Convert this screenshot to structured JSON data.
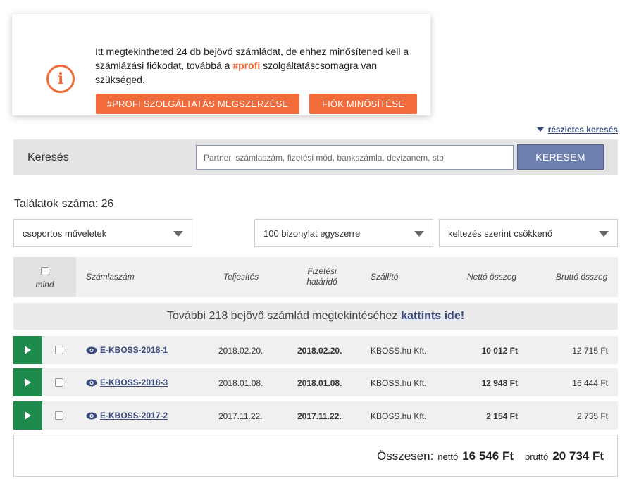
{
  "notice": {
    "text_before": "Itt megtekintheted 24 db bejövő számládat, de ehhez minősítened kell a számlázási fiókodat, továbbá a ",
    "highlight": "#profi",
    "text_after": " szolgáltatáscsomagra van szükséged.",
    "profi_button": "#PROFI SZOLGÁLTATÁS MEGSZERZÉSE",
    "fiok_button": "FIÓK MINŐSÍTÉSE",
    "icon": "info-icon",
    "accent": "#f26b3a"
  },
  "advanced_search": "részletes keresés",
  "search": {
    "label": "Keresés",
    "placeholder": "Partner, számlaszám, fizetési mód, bankszámla, devizanem, stb",
    "button": "KERESEM"
  },
  "results": {
    "count_label": "Találatok száma: 26"
  },
  "selects": {
    "group_actions": "csoportos műveletek",
    "per_page": "100 bizonylat egyszerre",
    "sort": "keltezés szerint csökkenő"
  },
  "table": {
    "select_all": "mind",
    "headers": {
      "invoice": "Számlaszám",
      "fulfillment": "Teljesítés",
      "due_line1": "Fizetési",
      "due_line2": "határidő",
      "supplier": "Szállító",
      "net": "Nettó összeg",
      "gross": "Bruttó összeg"
    },
    "more_text": "További 218 bejövő számlád megtekintéséhez",
    "more_link": "kattints ide!",
    "rows": [
      {
        "invoice": "E-KBOSS-2018-1",
        "fulfillment": "2018.02.20.",
        "due": "2018.02.20.",
        "supplier": "KBOSS.hu Kft.",
        "net": "10 012 Ft",
        "gross": "12 715 Ft"
      },
      {
        "invoice": "E-KBOSS-2018-3",
        "fulfillment": "2018.01.08.",
        "due": "2018.01.08.",
        "supplier": "KBOSS.hu Kft.",
        "net": "12 948 Ft",
        "gross": "16 444 Ft"
      },
      {
        "invoice": "E-KBOSS-2017-2",
        "fulfillment": "2017.11.22.",
        "due": "2017.11.22.",
        "supplier": "KBOSS.hu Kft.",
        "net": "2 154 Ft",
        "gross": "2 735 Ft"
      }
    ]
  },
  "totals": {
    "label": "Összesen:",
    "net_label": "nettó",
    "net_value": "16 546 Ft",
    "gross_label": "bruttó",
    "gross_value": "20 734 Ft"
  }
}
